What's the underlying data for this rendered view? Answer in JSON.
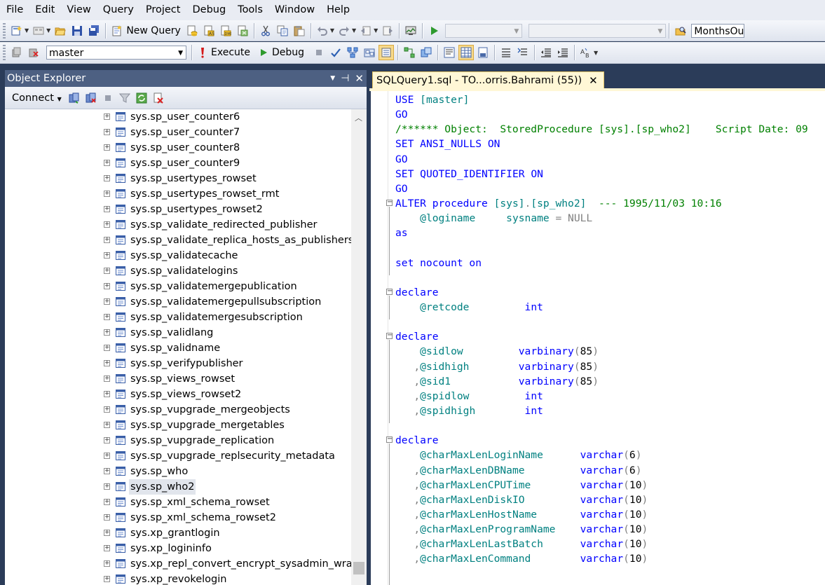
{
  "menu": [
    "File",
    "Edit",
    "View",
    "Query",
    "Project",
    "Debug",
    "Tools",
    "Window",
    "Help"
  ],
  "toolbar1": {
    "new_query_label": "New Query",
    "months_combo_value": "MonthsOu",
    "icons": [
      "new-project-icon",
      "add-item-icon",
      "open-file-icon",
      "save-icon",
      "save-all-icon",
      "new-query-icon",
      "db-engine-query-icon",
      "analysis-query-icon",
      "mdx-query-icon",
      "xmla-query-icon",
      "cut-icon",
      "copy-icon",
      "paste-icon",
      "undo-icon",
      "redo-icon",
      "navigate-backward-icon",
      "navigate-forward-icon",
      "activity-monitor-icon",
      "start-debugging-icon",
      "find-in-files-icon"
    ]
  },
  "toolbar2": {
    "database_value": "master",
    "execute_label": "Execute",
    "debug_label": "Debug"
  },
  "object_explorer": {
    "title": "Object Explorer",
    "connect_label": "Connect",
    "items": [
      "sys.sp_user_counter6",
      "sys.sp_user_counter7",
      "sys.sp_user_counter8",
      "sys.sp_user_counter9",
      "sys.sp_usertypes_rowset",
      "sys.sp_usertypes_rowset_rmt",
      "sys.sp_usertypes_rowset2",
      "sys.sp_validate_redirected_publisher",
      "sys.sp_validate_replica_hosts_as_publishers",
      "sys.sp_validatecache",
      "sys.sp_validatelogins",
      "sys.sp_validatemergepublication",
      "sys.sp_validatemergepullsubscription",
      "sys.sp_validatemergesubscription",
      "sys.sp_validlang",
      "sys.sp_validname",
      "sys.sp_verifypublisher",
      "sys.sp_views_rowset",
      "sys.sp_views_rowset2",
      "sys.sp_vupgrade_mergeobjects",
      "sys.sp_vupgrade_mergetables",
      "sys.sp_vupgrade_replication",
      "sys.sp_vupgrade_replsecurity_metadata",
      "sys.sp_who",
      "sys.sp_who2",
      "sys.sp_xml_schema_rowset",
      "sys.sp_xml_schema_rowset2",
      "sys.xp_grantlogin",
      "sys.xp_logininfo",
      "sys.xp_repl_convert_encrypt_sysadmin_wrapper",
      "sys.xp_revokelogin"
    ],
    "selected_item": "sys.sp_who2"
  },
  "editor": {
    "tab_title": "SQLQuery1.sql - TO...orris.Bahrami (55))",
    "lines": [
      [
        [
          "kw",
          "USE "
        ],
        [
          "tl",
          "[master]"
        ]
      ],
      [
        [
          "kw",
          "GO"
        ]
      ],
      [
        [
          "cm",
          "/****** Object:  StoredProcedure [sys].[sp_who2]    Script Date: 09"
        ]
      ],
      [
        [
          "kw",
          "SET "
        ],
        [
          "kw",
          "ANSI_NULLS "
        ],
        [
          "kw",
          "ON"
        ]
      ],
      [
        [
          "kw",
          "GO"
        ]
      ],
      [
        [
          "kw",
          "SET "
        ],
        [
          "kw",
          "QUOTED_IDENTIFIER "
        ],
        [
          "kw",
          "ON"
        ]
      ],
      [
        [
          "kw",
          "GO"
        ]
      ],
      [
        [
          "kw",
          "ALTER procedure "
        ],
        [
          "tl",
          "[sys]"
        ],
        [
          "gr",
          "."
        ],
        [
          "tl",
          "[sp_who2]"
        ],
        [
          "cm",
          "  --- 1995/11/03 10:16"
        ]
      ],
      [
        [
          "pl",
          "    "
        ],
        [
          "tl",
          "@loginame"
        ],
        [
          "pl",
          "     "
        ],
        [
          "tl",
          "sysname "
        ],
        [
          "gr",
          "= NULL"
        ]
      ],
      [
        [
          "kw",
          "as"
        ]
      ],
      [
        [
          "pl",
          ""
        ]
      ],
      [
        [
          "kw",
          "set nocount on"
        ]
      ],
      [
        [
          "pl",
          ""
        ]
      ],
      [
        [
          "kw",
          "declare"
        ]
      ],
      [
        [
          "pl",
          "    "
        ],
        [
          "tl",
          "@retcode"
        ],
        [
          "pl",
          "         "
        ],
        [
          "kw",
          "int"
        ]
      ],
      [
        [
          "pl",
          ""
        ]
      ],
      [
        [
          "kw",
          "declare"
        ]
      ],
      [
        [
          "pl",
          "    "
        ],
        [
          "tl",
          "@sidlow"
        ],
        [
          "pl",
          "         "
        ],
        [
          "kw",
          "varbinary"
        ],
        [
          "gr",
          "("
        ],
        [
          "pl",
          "85"
        ],
        [
          "gr",
          ")"
        ]
      ],
      [
        [
          "pl",
          "   "
        ],
        [
          "gr",
          ","
        ],
        [
          "tl",
          "@sidhigh"
        ],
        [
          "pl",
          "        "
        ],
        [
          "kw",
          "varbinary"
        ],
        [
          "gr",
          "("
        ],
        [
          "pl",
          "85"
        ],
        [
          "gr",
          ")"
        ]
      ],
      [
        [
          "pl",
          "   "
        ],
        [
          "gr",
          ","
        ],
        [
          "tl",
          "@sid1"
        ],
        [
          "pl",
          "           "
        ],
        [
          "kw",
          "varbinary"
        ],
        [
          "gr",
          "("
        ],
        [
          "pl",
          "85"
        ],
        [
          "gr",
          ")"
        ]
      ],
      [
        [
          "pl",
          "   "
        ],
        [
          "gr",
          ","
        ],
        [
          "tl",
          "@spidlow"
        ],
        [
          "pl",
          "         "
        ],
        [
          "kw",
          "int"
        ]
      ],
      [
        [
          "pl",
          "   "
        ],
        [
          "gr",
          ","
        ],
        [
          "tl",
          "@spidhigh"
        ],
        [
          "pl",
          "        "
        ],
        [
          "kw",
          "int"
        ]
      ],
      [
        [
          "pl",
          ""
        ]
      ],
      [
        [
          "kw",
          "declare"
        ]
      ],
      [
        [
          "pl",
          "    "
        ],
        [
          "tl",
          "@charMaxLenLoginName"
        ],
        [
          "pl",
          "      "
        ],
        [
          "kw",
          "varchar"
        ],
        [
          "gr",
          "("
        ],
        [
          "pl",
          "6"
        ],
        [
          "gr",
          ")"
        ]
      ],
      [
        [
          "pl",
          "   "
        ],
        [
          "gr",
          ","
        ],
        [
          "tl",
          "@charMaxLenDBName"
        ],
        [
          "pl",
          "         "
        ],
        [
          "kw",
          "varchar"
        ],
        [
          "gr",
          "("
        ],
        [
          "pl",
          "6"
        ],
        [
          "gr",
          ")"
        ]
      ],
      [
        [
          "pl",
          "   "
        ],
        [
          "gr",
          ","
        ],
        [
          "tl",
          "@charMaxLenCPUTime"
        ],
        [
          "pl",
          "        "
        ],
        [
          "kw",
          "varchar"
        ],
        [
          "gr",
          "("
        ],
        [
          "pl",
          "10"
        ],
        [
          "gr",
          ")"
        ]
      ],
      [
        [
          "pl",
          "   "
        ],
        [
          "gr",
          ","
        ],
        [
          "tl",
          "@charMaxLenDiskIO"
        ],
        [
          "pl",
          "         "
        ],
        [
          "kw",
          "varchar"
        ],
        [
          "gr",
          "("
        ],
        [
          "pl",
          "10"
        ],
        [
          "gr",
          ")"
        ]
      ],
      [
        [
          "pl",
          "   "
        ],
        [
          "gr",
          ","
        ],
        [
          "tl",
          "@charMaxLenHostName"
        ],
        [
          "pl",
          "       "
        ],
        [
          "kw",
          "varchar"
        ],
        [
          "gr",
          "("
        ],
        [
          "pl",
          "10"
        ],
        [
          "gr",
          ")"
        ]
      ],
      [
        [
          "pl",
          "   "
        ],
        [
          "gr",
          ","
        ],
        [
          "tl",
          "@charMaxLenProgramName"
        ],
        [
          "pl",
          "    "
        ],
        [
          "kw",
          "varchar"
        ],
        [
          "gr",
          "("
        ],
        [
          "pl",
          "10"
        ],
        [
          "gr",
          ")"
        ]
      ],
      [
        [
          "pl",
          "   "
        ],
        [
          "gr",
          ","
        ],
        [
          "tl",
          "@charMaxLenLastBatch"
        ],
        [
          "pl",
          "      "
        ],
        [
          "kw",
          "varchar"
        ],
        [
          "gr",
          "("
        ],
        [
          "pl",
          "10"
        ],
        [
          "gr",
          ")"
        ]
      ],
      [
        [
          "pl",
          "   "
        ],
        [
          "gr",
          ","
        ],
        [
          "tl",
          "@charMaxLenCommand"
        ],
        [
          "pl",
          "        "
        ],
        [
          "kw",
          "varchar"
        ],
        [
          "gr",
          "("
        ],
        [
          "pl",
          "10"
        ],
        [
          "gr",
          ")"
        ]
      ]
    ],
    "fold_lines": [
      7,
      13,
      16,
      23
    ]
  }
}
